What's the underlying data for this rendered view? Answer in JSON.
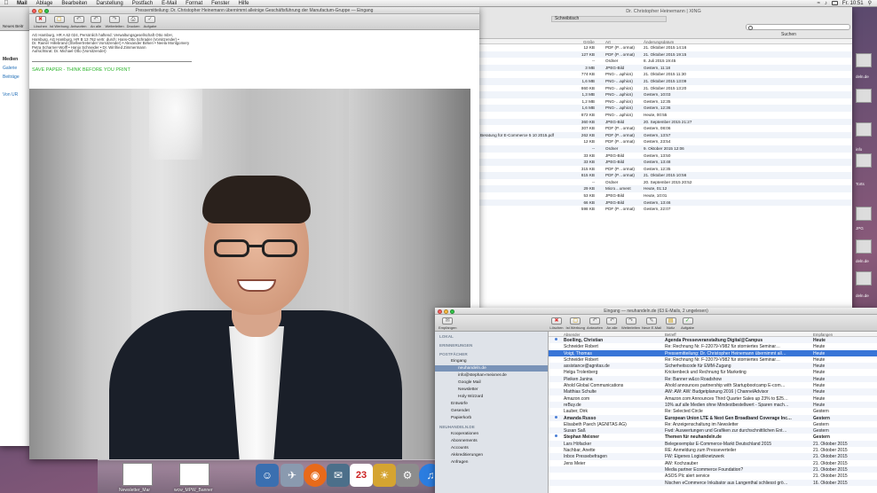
{
  "menubar": {
    "app": "Mail",
    "items": [
      "Ablage",
      "Bearbeiten",
      "Darstellung",
      "Postfach",
      "E-Mail",
      "Format",
      "Fenster",
      "Hilfe"
    ],
    "clock": "Fr. 10:51"
  },
  "message_window": {
    "title": "Pressemitteilung: Dr. Christopher Heinemann übernimmt alleinige Geschäftsführung der Manufactum-Gruppe — Eingang",
    "toolbar": [
      "Löschen",
      "Ist Werbung",
      "Antworten",
      "An alle",
      "Weiterleiten",
      "Drucken",
      "Aufgabe"
    ],
    "legal_lines": [
      "AG Hamburg, HR A 62 024, Persönlich haftend: Verwaltungsgesellschaft Otto mbH,",
      "Hamburg, AG Hamburg, HR B 13 762 vertr. durch: Hans-Otto Schrader (Vorsitzender) •",
      "Dr. Rainer Hillebrand (Stellvertretender Vorsitzender) • Alexander Birken • Neela Montgomery",
      "Petra Scharner-Wolff • Hanjo Schneider • Dr. Winfried Zimmermann",
      "Aufsichtsrat: Dr. Michael Otto (Vorsitzender)"
    ],
    "green_line": "SAVE PAPER - THINK BEFORE YOU PRINT"
  },
  "left_window": {
    "toolbar_label": "Neues Beitr",
    "lines": [
      "Medien",
      "Galerie",
      "Beiträge",
      "Von UR"
    ]
  },
  "finder": {
    "title": "Dr. Christopher Heinemann | XING",
    "crumb": "Schreibtisch",
    "search_button": "Suchen",
    "columns": [
      "Größe",
      "Art",
      "Änderungsdatum"
    ],
    "rows": [
      {
        "name": "",
        "size": "12 KB",
        "kind": "PDF (P…ormat)",
        "date": "21. Oktober 2015 14:16"
      },
      {
        "name": "",
        "size": "127 KB",
        "kind": "PDF (P…ormat)",
        "date": "21. Oktober 2015 19:15"
      },
      {
        "name": "",
        "size": "--",
        "kind": "Ordner",
        "date": "8. Juli 2015 19:45"
      },
      {
        "name": "",
        "size": "3 MB",
        "kind": "JPEG-Bild",
        "date": "Gestern, 11:18"
      },
      {
        "name": "",
        "size": "774 KB",
        "kind": "PNG-…aphics)",
        "date": "21. Oktober 2015 11:30"
      },
      {
        "name": "",
        "size": "1,6 MB",
        "kind": "PNG-…aphics)",
        "date": "21. Oktober 2015 13:09"
      },
      {
        "name": "",
        "size": "860 KB",
        "kind": "PNG-…aphics)",
        "date": "21. Oktober 2015 13:20"
      },
      {
        "name": "",
        "size": "1,3 MB",
        "kind": "PNG-…aphics)",
        "date": "Gestern, 10:03"
      },
      {
        "name": "",
        "size": "1,2 MB",
        "kind": "PNG-…aphics)",
        "date": "Gestern, 12:35"
      },
      {
        "name": "",
        "size": "1,6 MB",
        "kind": "PNG-…aphics)",
        "date": "Gestern, 12:36"
      },
      {
        "name": "",
        "size": "872 KB",
        "kind": "PNG-…aphics)",
        "date": "Heute, 00:55"
      },
      {
        "name": "",
        "size": "360 KB",
        "kind": "JPEG-Bild",
        "date": "20. September 2015 21:27"
      },
      {
        "name": "",
        "size": "307 KB",
        "kind": "PDF (P…ormat)",
        "date": "Gestern, 08:06"
      },
      {
        "name": "Beratung für E-Commerce 5 10 2015.pdf",
        "size": "262 KB",
        "kind": "PDF (P…ormat)",
        "date": "Gestern, 13:57"
      },
      {
        "name": "",
        "size": "12 KB",
        "kind": "PDF (P…ormat)",
        "date": "Gestern, 23:54"
      },
      {
        "name": "",
        "size": "--",
        "kind": "Ordner",
        "date": "9. Oktober 2015 12:06"
      },
      {
        "name": "",
        "size": "33 KB",
        "kind": "JPEG-Bild",
        "date": "Gestern, 13:50"
      },
      {
        "name": "",
        "size": "33 KB",
        "kind": "JPEG-Bild",
        "date": "Gestern, 13:48"
      },
      {
        "name": "",
        "size": "315 KB",
        "kind": "PDF (P…ormat)",
        "date": "Gestern, 12:35"
      },
      {
        "name": "",
        "size": "815 KB",
        "kind": "PDF (P…ormat)",
        "date": "21. Oktober 2015 10:56"
      },
      {
        "name": "",
        "size": "--",
        "kind": "Ordner",
        "date": "20. September 2015 20:52"
      },
      {
        "name": "",
        "size": "29 KB",
        "kind": "Micro…ument",
        "date": "Heute, 01:12"
      },
      {
        "name": "",
        "size": "53 KB",
        "kind": "JPEG-Bild",
        "date": "Heute, 10:01"
      },
      {
        "name": "",
        "size": "66 KB",
        "kind": "JPEG-Bild",
        "date": "Gestern, 13:46"
      },
      {
        "name": "",
        "size": "598 KB",
        "kind": "PDF (P…ormat)",
        "date": "Gestern, 22:07"
      }
    ]
  },
  "mail_window": {
    "title": "Eingang — neuhandeln.de (63 E-Mails, 2 ungelesen)",
    "toolbar": [
      "Empfangen",
      "Löschen",
      "Ist Werbung",
      "Antworten",
      "An alle",
      "Weiterleiten",
      "Neue E-Mail",
      "Notiz",
      "Aufgabe"
    ],
    "sidebar": {
      "local": "LOKAL",
      "reminders": "ERINNERUNGEN",
      "mailboxes": "POSTFÄCHER",
      "inbox": "Eingang",
      "accounts": [
        "neuhandeln.de",
        "info@stephan-meixner.de",
        "Google Mail",
        "Newsletter",
        "Holy Wizzard"
      ],
      "drafts": "Entwürfe",
      "sent": "Gesendet",
      "trash": "Papierkorb",
      "neuhandeln_header": "NEUHANDELN.DE",
      "folders": [
        "Kooperationen",
        "Abonnements",
        "Accounts",
        "Akkreditierungen",
        "Anfragen"
      ]
    },
    "columns": [
      "Absender",
      "Betreff",
      "Empfangen"
    ],
    "messages": [
      {
        "from": "Boelling, Christian",
        "subject": "Agenda Presseveranstaltung Digital@Campus",
        "date": "Heute",
        "unread": true
      },
      {
        "from": "Schneider Robert",
        "subject": "Re: Rechnung Nr. F-22079-V982 für storniertes Seminar…",
        "date": "Heute",
        "unread": false
      },
      {
        "from": "Voigt, Thomas",
        "subject": "Pressemitteilung: Dr. Christopher Heinemann übernimmt all…",
        "date": "Heute",
        "unread": false,
        "selected": true
      },
      {
        "from": "Schneider Robert",
        "subject": "Re: Rechnung Nr. F-22079-V982 für storniertes Seminar…",
        "date": "Heute",
        "unread": false
      },
      {
        "from": "assistance@agnitas.de",
        "subject": "Sicherheitscode für EMM-Zugang",
        "date": "Heute",
        "unread": false
      },
      {
        "from": "Helga Trolenberg",
        "subject": "Krickenbeck und Rechnung für Marketing",
        "date": "Heute",
        "unread": false
      },
      {
        "from": "Pleiken Janina",
        "subject": "Re: Banner w&co Roadshow",
        "date": "Heute",
        "unread": false
      },
      {
        "from": "Ahold Global Communications",
        "subject": "Ahold announces partnership with Startupbootcamp E-com…",
        "date": "Heute",
        "unread": false
      },
      {
        "from": "Matthias Schulte",
        "subject": "AW: AW: AW: Budgetplanung 2016 | ChannelAdvisor",
        "date": "Heute",
        "unread": false
      },
      {
        "from": "Amazon.com",
        "subject": "Amazon.com Announces Third Quarter Sales up 23% to $25…",
        "date": "Heute",
        "unread": false
      },
      {
        "from": "reBuy.de",
        "subject": "10% auf alle Medien ohne Mindestbestellwert - Sparen mach…",
        "date": "Heute",
        "unread": false
      },
      {
        "from": "Lauber, Dirk",
        "subject": "Re: Selected Circle",
        "date": "Gestern",
        "unread": false
      },
      {
        "from": "Amanda Russo",
        "subject": "European Union LTE & Next Gen Broadband Coverage Inc…",
        "date": "Gestern",
        "unread": true
      },
      {
        "from": "Elisabeth Paech (AGNITAS AG)",
        "subject": "Re: Anzeigenschaltung im Newsletter",
        "date": "Gestern",
        "unread": false
      },
      {
        "from": "Susan Saß",
        "subject": "Fwd: Auswertungen und Grafiken zur durchschnittlichen Ent…",
        "date": "Gestern",
        "unread": false
      },
      {
        "from": "Stephan Meixner",
        "subject": "Themen für neuhandeln.de",
        "date": "Gestern",
        "unread": true
      },
      {
        "from": "Lars Höfacker",
        "subject": "Belegexemplar E-Commerce-Markt Deutschland 2015",
        "date": "21. Oktober 2015",
        "unread": false
      },
      {
        "from": "Nachbar, Anette",
        "subject": "RE: Anmeldung zum Presseverteiler",
        "date": "21. Oktober 2015",
        "unread": false
      },
      {
        "from": "Inbox Pressebefragen",
        "subject": "FW: Eigenes Logistiknetzwerk",
        "date": "21. Oktober 2015",
        "unread": false
      },
      {
        "from": "Jens Meier",
        "subject": "AW: Kochzauber",
        "date": "21. Oktober 2015",
        "unread": false
      },
      {
        "from": "",
        "subject": "Media partner Ecommerce Foundation?",
        "date": "21. Oktober 2015",
        "unread": false
      },
      {
        "from": "",
        "subject": "ASOS Plc alert service",
        "date": "21. Oktober 2015",
        "unread": false
      },
      {
        "from": "",
        "subject": "Nischen eCommerce Inkubator aus Langenthal schliesst grö…",
        "date": "16. Oktober 2015",
        "unread": false
      }
    ]
  },
  "right_strip": [
    "deln.de",
    "info",
    "Wurzel",
    "Torts",
    "JPG",
    "deln.de",
    "Info",
    "deln.de"
  ],
  "dock": {
    "labels": [
      "Newsletter_Mar",
      "wcw_MPW_Banner"
    ],
    "date_icon": "23"
  }
}
